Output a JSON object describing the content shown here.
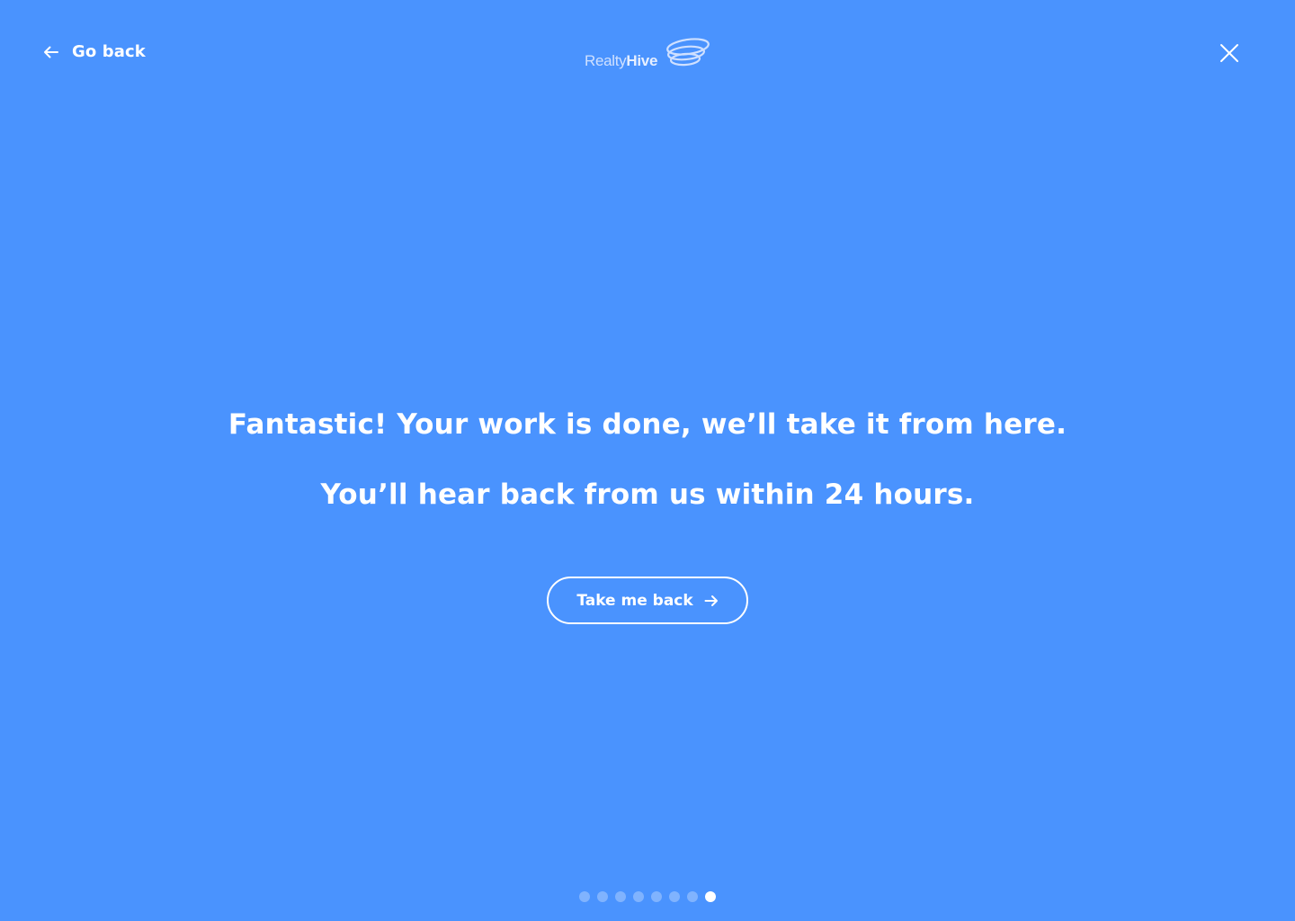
{
  "colors": {
    "background": "#4a93fe",
    "foreground": "#ffffff"
  },
  "header": {
    "back_label": "Go back",
    "back_icon": "arrow-left-icon",
    "logo": {
      "word_light": "Realty",
      "word_bold": "Hive",
      "icon": "orbit-rings-icon"
    },
    "close_icon": "close-icon"
  },
  "main": {
    "headline": "Fantastic! Your work is done, we’ll take it from here.",
    "subline": "You’ll hear back from us within 24 hours.",
    "cta_label": "Take me back",
    "cta_icon": "arrow-right-icon"
  },
  "pagination": {
    "total_steps": 8,
    "current_step": 8
  }
}
